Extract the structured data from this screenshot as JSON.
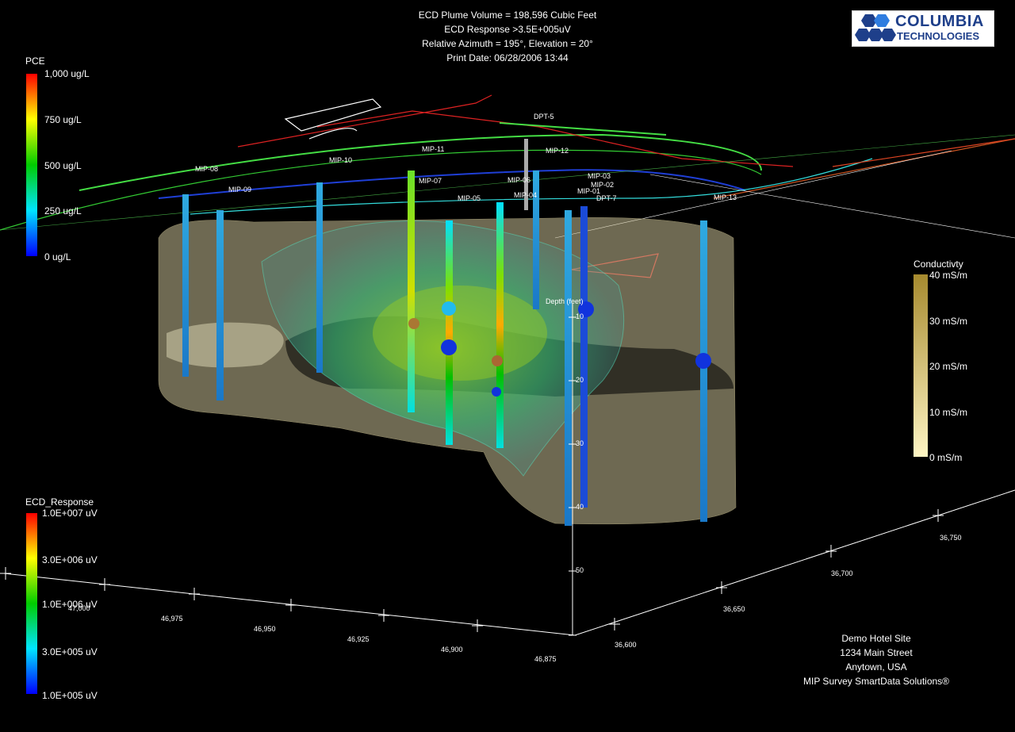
{
  "header": {
    "line1": "ECD Plume Volume = 198,596 Cubic Feet",
    "line2": "ECD Response >3.5E+005uV",
    "line3": "Relative Azimuth = 195°, Elevation = 20°",
    "line4": "Print Date: 06/28/2006 13:44"
  },
  "logo": {
    "word1": "COLUMBIA",
    "word2": "TECHNOLOGIES",
    "color": "#1e3f8a"
  },
  "pce_legend": {
    "title": "PCE",
    "labels": [
      "1,000 ug/L",
      "750 ug/L",
      "500 ug/L",
      "250 ug/L",
      "0 ug/L"
    ],
    "colors": [
      "#ff0000",
      "#ffff00",
      "#00cc00",
      "#00e5ff",
      "#0000ff"
    ]
  },
  "ecd_legend": {
    "title": "ECD_Response",
    "labels": [
      "1.0E+007 uV",
      "3.0E+006 uV",
      "1.0E+006 uV",
      "3.0E+005 uV",
      "1.0E+005 uV"
    ],
    "colors": [
      "#ff0000",
      "#ffff00",
      "#00cc00",
      "#00e5ff",
      "#0000ff"
    ]
  },
  "conductivity_legend": {
    "title": "Conductivty",
    "labels": [
      "40 mS/m",
      "30 mS/m",
      "20 mS/m",
      "10 mS/m",
      "0 mS/m"
    ],
    "colors": [
      "#a68a2e",
      "#fff6c4"
    ]
  },
  "footer": {
    "line1": "Demo Hotel Site",
    "line2": "1234 Main Street",
    "line3": "Anytown, USA",
    "line4": "MIP Survey SmartData Solutions®"
  },
  "x_axis_labels": [
    "47,000",
    "46,975",
    "46,950",
    "46,925",
    "46,900",
    "46,875"
  ],
  "y_axis_labels": [
    "36,600",
    "36,650",
    "36,700",
    "36,750"
  ],
  "depth_label": "Depth (feet)",
  "depth_ticks": [
    "10",
    "20",
    "30",
    "40",
    "50"
  ],
  "borehole_labels": [
    "DPT-5",
    "MIP-11",
    "MIP-12",
    "MIP-08",
    "MIP-10",
    "MIP-09",
    "MIP-07",
    "MIP-06",
    "MIP-05",
    "MIP-04",
    "MIP-03",
    "MIP-02",
    "MIP-01",
    "DPT-7",
    "MIP-13"
  ]
}
